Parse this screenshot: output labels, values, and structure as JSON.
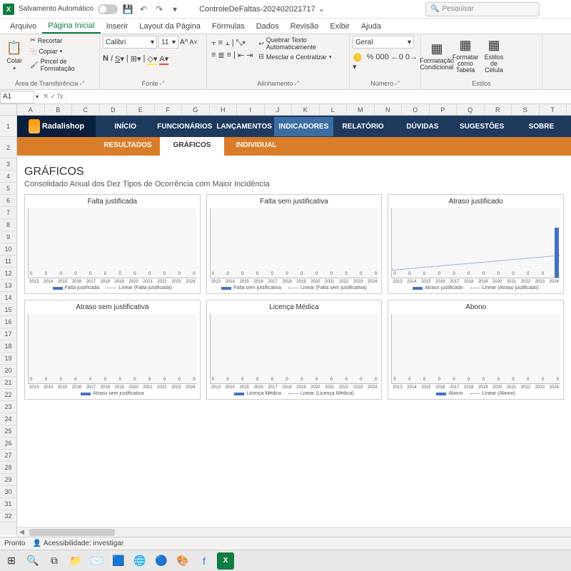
{
  "titlebar": {
    "autosave": "Salvamento Automático",
    "filename": "ControleDeFaltas-202402021717",
    "search_placeholder": "Pesquisar"
  },
  "menu": [
    "Arquivo",
    "Página Inicial",
    "Inserir",
    "Layout da Página",
    "Fórmulas",
    "Dados",
    "Revisão",
    "Exibir",
    "Ajuda"
  ],
  "menu_active": 1,
  "ribbon": {
    "clipboard": {
      "paste": "Colar",
      "cut": "Recortar",
      "copy": "Copiar",
      "format_painter": "Pincel de Formatação",
      "label": "Área de Transferência"
    },
    "font": {
      "name": "Calibri",
      "size": "11",
      "label": "Fonte"
    },
    "alignment": {
      "wrap": "Quebrar Texto Automaticamente",
      "merge": "Mesclar e Centralizar",
      "label": "Alinhamento"
    },
    "number": {
      "format": "Geral",
      "label": "Número"
    },
    "styles": {
      "cond": "Formatação Condicional",
      "table": "Formatar como Tabela",
      "cell": "Estilos de Célula",
      "label": "Estilos"
    }
  },
  "formulabar": {
    "cell": "A1",
    "fx": "fx"
  },
  "columns": [
    "A",
    "B",
    "C",
    "D",
    "E",
    "F",
    "G",
    "H",
    "I",
    "J",
    "K",
    "L",
    "M",
    "N",
    "O",
    "P",
    "Q",
    "R",
    "S",
    "T"
  ],
  "rows": [
    "1",
    "2",
    "3",
    "4",
    "5",
    "6",
    "7",
    "8",
    "9",
    "10",
    "11",
    "12",
    "13",
    "14",
    "15",
    "16",
    "17",
    "18",
    "19",
    "20",
    "21",
    "22",
    "23",
    "24",
    "25",
    "26",
    "27",
    "28",
    "29",
    "30",
    "31",
    "32"
  ],
  "appnav": {
    "logo": "Radalishop",
    "items": [
      "INÍCIO",
      "FUNCIONÁRIOS",
      "LANÇAMENTOS",
      "INDICADORES",
      "RELATÓRIO",
      "DÚVIDAS",
      "SUGESTÕES",
      "SOBRE"
    ],
    "active": 3
  },
  "subnav": {
    "items": [
      "RESULTADOS",
      "GRÁFICOS",
      "INDIVIDUAL"
    ],
    "active": 1
  },
  "content": {
    "title": "GRÁFICOS",
    "subtitle": "Consolidado Anual dos Dez Tipos de Ocorrência com Maior Incidência"
  },
  "chart_data": [
    {
      "type": "bar",
      "title": "Falta justificada",
      "categories": [
        "2013",
        "2014",
        "2015",
        "2016",
        "2017",
        "2018",
        "2019",
        "2020",
        "2021",
        "2022",
        "2023",
        "2024"
      ],
      "values": [
        0,
        0,
        0,
        0,
        0,
        0,
        0,
        0,
        0,
        0,
        0,
        0
      ],
      "series_name": "Falta justificada",
      "trend_name": "Linear (Falta justificada)"
    },
    {
      "type": "bar",
      "title": "Falta sem justificativa",
      "categories": [
        "2013",
        "2014",
        "2015",
        "2016",
        "2017",
        "2018",
        "2019",
        "2020",
        "2021",
        "2022",
        "2023",
        "2024"
      ],
      "values": [
        0,
        0,
        0,
        0,
        0,
        0,
        0,
        0,
        0,
        0,
        0,
        0
      ],
      "series_name": "Falta sem justificativa",
      "trend_name": "Linear (Falta sem justificativa)"
    },
    {
      "type": "bar",
      "title": "Atraso justificado",
      "categories": [
        "2013",
        "2014",
        "2015",
        "2016",
        "2017",
        "2018",
        "2019",
        "2020",
        "2021",
        "2022",
        "2023",
        "2024"
      ],
      "values": [
        0,
        0,
        0,
        0,
        0,
        0,
        0,
        0,
        0,
        0,
        0,
        1
      ],
      "series_name": "Atraso justificado",
      "trend_name": "Linear (Atraso justificado)"
    },
    {
      "type": "bar",
      "title": "Atraso sem justificativa",
      "categories": [
        "2013",
        "2014",
        "2015",
        "2016",
        "2017",
        "2018",
        "2019",
        "2020",
        "2021",
        "2022",
        "2023",
        "2024"
      ],
      "values": [
        0,
        0,
        0,
        0,
        0,
        0,
        0,
        0,
        0,
        0,
        0,
        0
      ],
      "series_name": "Atraso sem justificativa",
      "trend_name": ""
    },
    {
      "type": "bar",
      "title": "Licença Médica",
      "categories": [
        "2013",
        "2014",
        "2015",
        "2016",
        "2017",
        "2018",
        "2019",
        "2020",
        "2021",
        "2022",
        "2023",
        "2024"
      ],
      "values": [
        0,
        0,
        0,
        0,
        0,
        0,
        0,
        0,
        0,
        0,
        0,
        0
      ],
      "series_name": "Licença Médica",
      "trend_name": "Linear (Licença Médica)"
    },
    {
      "type": "bar",
      "title": "Abono",
      "categories": [
        "2013",
        "2014",
        "2015",
        "2016",
        "2017",
        "2018",
        "2019",
        "2020",
        "2021",
        "2022",
        "2023",
        "2024"
      ],
      "values": [
        0,
        0,
        0,
        0,
        0,
        0,
        0,
        0,
        0,
        0,
        0,
        0
      ],
      "series_name": "Abono",
      "trend_name": "Linear (Abono)"
    }
  ],
  "statusbar": {
    "ready": "Pronto",
    "accessibility": "Acessibilidade: investigar"
  }
}
